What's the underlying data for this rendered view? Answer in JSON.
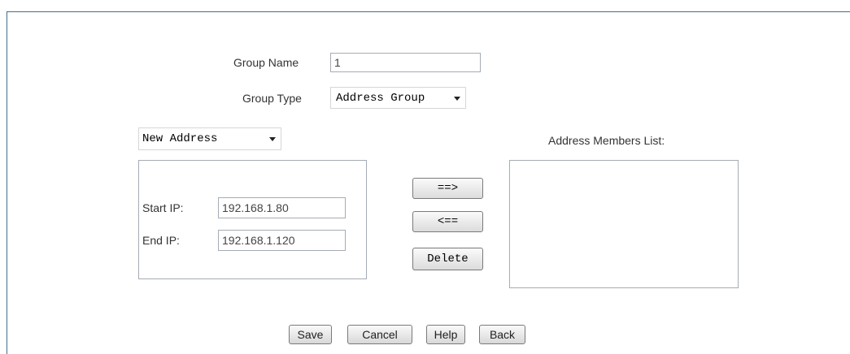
{
  "group_name": {
    "label": "Group Name",
    "value": "1"
  },
  "group_type": {
    "label": "Group Type",
    "value": "Address Group"
  },
  "address_type": {
    "value": "New Address"
  },
  "start_ip": {
    "label": "Start IP:",
    "value": "192.168.1.80"
  },
  "end_ip": {
    "label": "End IP:",
    "value": "192.168.1.120"
  },
  "transfer": {
    "add_label": "==>",
    "remove_label": "<==",
    "delete_label": "Delete"
  },
  "members": {
    "label": "Address Members List:",
    "items": []
  },
  "actions": {
    "save": "Save",
    "cancel": "Cancel",
    "help": "Help",
    "back": "Back"
  }
}
